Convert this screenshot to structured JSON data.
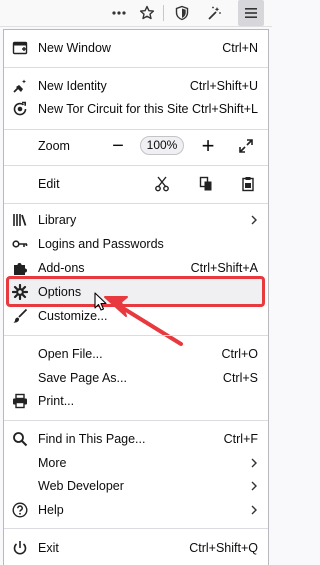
{
  "menu": {
    "new_window": {
      "label": "New Window",
      "shortcut": "Ctrl+N"
    },
    "new_identity": {
      "label": "New Identity",
      "shortcut": "Ctrl+Shift+U"
    },
    "new_circuit": {
      "label": "New Tor Circuit for this Site",
      "shortcut": "Ctrl+Shift+L"
    },
    "zoom": {
      "label": "Zoom",
      "minus": "−",
      "percent": "100%",
      "plus": "+"
    },
    "edit": {
      "label": "Edit"
    },
    "library": {
      "label": "Library"
    },
    "logins": {
      "label": "Logins and Passwords"
    },
    "addons": {
      "label": "Add-ons",
      "shortcut": "Ctrl+Shift+A"
    },
    "options": {
      "label": "Options"
    },
    "customize": {
      "label": "Customize..."
    },
    "open_file": {
      "label": "Open File...",
      "shortcut": "Ctrl+O"
    },
    "save_page": {
      "label": "Save Page As...",
      "shortcut": "Ctrl+S"
    },
    "print": {
      "label": "Print..."
    },
    "find": {
      "label": "Find in This Page...",
      "shortcut": "Ctrl+F"
    },
    "more": {
      "label": "More"
    },
    "web_dev": {
      "label": "Web Developer"
    },
    "help": {
      "label": "Help"
    },
    "exit": {
      "label": "Exit",
      "shortcut": "Ctrl+Shift+Q"
    }
  },
  "annotation_color": "#e8393f",
  "highlighted_item": "options"
}
